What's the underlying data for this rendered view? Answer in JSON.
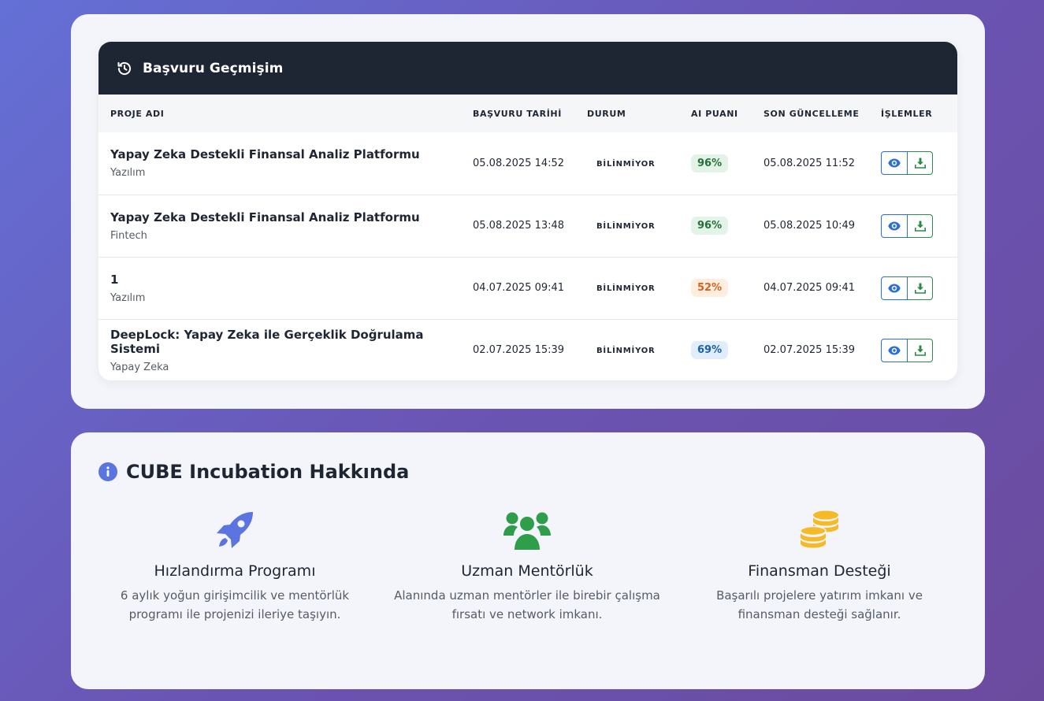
{
  "history": {
    "title": "Başvuru Geçmişim",
    "columns": [
      "PROJE ADI",
      "BAŞVURU TARİHİ",
      "DURUM",
      "AI PUANI",
      "SON GÜNCELLEME",
      "İŞLEMLER"
    ],
    "rows": [
      {
        "name": "Yapay Zeka Destekli Finansal Analiz Platformu",
        "category": "Yazılım",
        "date": "05.08.2025 14:52",
        "status": "BİLİNMİYOR",
        "score": "96%",
        "score_color": "green",
        "updated": "05.08.2025 11:52"
      },
      {
        "name": "Yapay Zeka Destekli Finansal Analiz Platformu",
        "category": "Fintech",
        "date": "05.08.2025 13:48",
        "status": "BİLİNMİYOR",
        "score": "96%",
        "score_color": "green",
        "updated": "05.08.2025 10:49"
      },
      {
        "name": "1",
        "category": "Yazılım",
        "date": "04.07.2025 09:41",
        "status": "BİLİNMİYOR",
        "score": "52%",
        "score_color": "orange",
        "updated": "04.07.2025 09:41"
      },
      {
        "name": "DeepLock: Yapay Zeka ile Gerçeklik Doğrulama Sistemi",
        "category": "Yapay Zeka",
        "date": "02.07.2025 15:39",
        "status": "BİLİNMİYOR",
        "score": "69%",
        "score_color": "blue",
        "updated": "02.07.2025 15:39"
      }
    ]
  },
  "about": {
    "title": "CUBE Incubation Hakkında",
    "features": [
      {
        "icon": "rocket-icon",
        "title": "Hızlandırma Programı",
        "desc_line1": "6 aylık yoğun girişimcilik ve mentörlük",
        "desc_line2": "programı ile projenizi ileriye taşıyın."
      },
      {
        "icon": "users-icon",
        "title": "Uzman Mentörlük",
        "desc_line1": "Alanında uzman mentörler ile birebir çalışma",
        "desc_line2": "fırsatı ve network imkanı."
      },
      {
        "icon": "coins-icon",
        "title": "Finansman Desteği",
        "desc_line1": "Başarılı projelere yatırım imkanı ve",
        "desc_line2": "finansman desteği sağlanır."
      }
    ]
  },
  "colors": {
    "header_bg": "#1f2633",
    "accent_blue": "#2b6fd6",
    "accent_green": "#2e8a4a",
    "rocket": "#5b74e0",
    "users": "#2f9e4a",
    "coins": "#f6b928"
  }
}
